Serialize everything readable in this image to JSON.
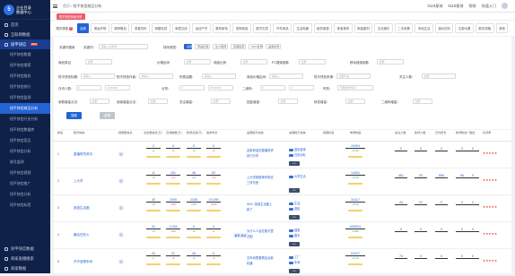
{
  "sidebar": {
    "logo_line1": "企业目录",
    "logo_line2": "数据中心",
    "home": "首页",
    "data_mgmt": "互联网数据",
    "group": "短平快信",
    "group_badge": "NEW",
    "items": [
      {
        "label": "短平快信数据"
      },
      {
        "label": "短平快信搜索"
      },
      {
        "label": "短平快信服务"
      },
      {
        "label": "短平快信排行"
      },
      {
        "label": "短平快信监测"
      },
      {
        "label": "短平快信商品分析",
        "active": true
      },
      {
        "label": "短平快信行业分析"
      },
      {
        "label": "短平快信数据库"
      },
      {
        "label": "短平快信竞品"
      },
      {
        "label": "短平快信分析"
      },
      {
        "label": "账号监测"
      },
      {
        "label": "短平快信视频"
      },
      {
        "label": "短平快信推广"
      },
      {
        "label": "短平快信分析"
      },
      {
        "label": "短平快信标签"
      }
    ],
    "bottom": [
      {
        "label": "短平快信数据"
      },
      {
        "label": "商家直播搜索"
      },
      {
        "label": "商家数据"
      }
    ]
  },
  "header": {
    "breadcrumb": [
      "首页",
      "短平快信商品分析"
    ],
    "right": [
      "5118星球",
      "5118星球",
      "帮助",
      "快速入门"
    ]
  },
  "tag": "短平快信商品分析",
  "menu": {
    "first": "短平快信",
    "first_badge": "2",
    "items": [
      "全部",
      "美妆护肤",
      "服饰鞋包",
      "零食饮料",
      "母婴玩具",
      "家居日用",
      "运动户外",
      "数码家电",
      "宠物用品",
      "图书文具",
      "汽车用品",
      "生活电器",
      "医药保健",
      "珠宝首饰",
      "家装建材",
      "文化娱乐",
      "二手闲置",
      "本地生活",
      "酒水饮料",
      "生鲜水果",
      "鲜花绿植",
      "其他"
    ]
  },
  "filters": {
    "row1_label": "关键词搜索",
    "row1_sub": "关键词：",
    "row1_ph": "请输入关键词",
    "row1_type": "排序类型：",
    "chips": [
      "全部",
      "商品标题",
      "达人昵称",
      "店铺名称",
      "SKU名称",
      "品牌名称"
    ],
    "row2": [
      {
        "label": "商品类目",
        "val": "全部",
        "label2": "品牌名称：",
        "val2": "全部"
      },
      {
        "label": "价格区间",
        "val": "全部"
      },
      {
        "label": "佣金比例",
        "val": "全部"
      },
      {
        "label": "PC搜索指数",
        "val": "全部"
      },
      {
        "label": "移动搜索指数",
        "val": "全部"
      }
    ],
    "row3": [
      {
        "label": "短平快信标题：",
        "ph": "请输入"
      },
      {
        "label": "短平快信作者：",
        "ph": "请输入"
      },
      {
        "label": "所属话题：",
        "ph": "请输入"
      },
      {
        "label": "商品价格区间：",
        "ph": "请输入"
      },
      {
        "label": "短平快信来源：",
        "ph": "全部平台"
      },
      {
        "label": "关注人数：",
        "ph": "全部"
      }
    ],
    "row4": [
      {
        "label": "日均人数：",
        "a": "0",
        "b": "1000000"
      },
      {
        "label": "点赞：",
        "a": "0",
        "b": "5000000"
      },
      {
        "label": "二维码：",
        "a": "0",
        "b": "4"
      },
      {
        "label": "时效：",
        "ph": "不限发布时间"
      }
    ],
    "row5": [
      {
        "label": "参数增量点击：",
        "val": "全部"
      },
      {
        "label": "阅读增量点击：",
        "val": "全部"
      },
      {
        "label": "关注增量：",
        "val": "全部"
      },
      {
        "label": "回复增量：",
        "val": "全部"
      },
      {
        "label": "转发增量：",
        "val": "全部"
      },
      {
        "label": "二维码增量：",
        "val": "全部"
      }
    ],
    "search_btn": "搜索",
    "reset_btn": "重置"
  },
  "table": {
    "headers": [
      "排名",
      "短平快信",
      "视频量信息",
      "点击量信息(万)",
      "互动数量(万)",
      "新增点赞(万)",
      "发布时长",
      "关联短平快信",
      "关联短平快信",
      "视频标签",
      "电商热度",
      "关注人数",
      "新增人数",
      "日均增长",
      "新增粉丝",
      "一致性",
      "好评率"
    ],
    "rows": [
      {
        "rank": "1",
        "name": "直播带货资讯",
        "v1": "2",
        "v1s": "+1",
        "v2": "0",
        "v2s": "+0",
        "v3": "0",
        "v3s": "+0",
        "v4": "0",
        "v4s": "+0",
        "topic": "这款商品的直播带货技巧分享",
        "kw": [
          "蓝色星球",
          "白色羽毛"
        ],
        "heat": "19394",
        "heat_s": "+5.6%",
        "h1": "0",
        "h2": "0",
        "h3": "0",
        "h4": "0",
        "h5": "0",
        "stars": "★★★★★"
      },
      {
        "rank": "2",
        "name": "上大学",
        "v1": "11",
        "v1s": "+3",
        "v2": "161",
        "v2s": "+41",
        "v3": "48",
        "v3s": "+12",
        "v4": "63",
        "v4s": "+15",
        "topic": "上大学我推荐你带这三样东西",
        "kw": [
          "大学生活"
        ],
        "heat": "14451",
        "heat_s": "+4.3%",
        "h1": "461",
        "h2": "93",
        "h3": "896",
        "h4": "96",
        "h5": "0",
        "stars": "★★★★★"
      },
      {
        "rank": "3",
        "name": "逛逛生活圈",
        "v1": "40",
        "v1s": "+8",
        "v2": "2490",
        "v2s": "+532",
        "v3": "2438",
        "v3s": "+470",
        "v4": "15,095",
        "v4s": "+3120",
        "topic": "WXC 逛逛生活圈上新了",
        "kw": [
          "生活",
          "逛街"
        ],
        "heat": "34117",
        "heat_s": "+6.1%",
        "h1": "43",
        "h2": "21",
        "h3": "0",
        "h4": "0",
        "h5": "0",
        "stars": "★★★★★"
      },
      {
        "rank": "4",
        "name": "最后还在火",
        "v1": "41",
        "v1s": "+9",
        "v2": "1,016",
        "v2s": "+210",
        "v3": "0",
        "v3s": "+0",
        "v4": "3",
        "v4s": "+1",
        "topic": "为什么人会在春天里犯困",
        "kw": [
          "健康",
          "春天"
        ],
        "heat": "699024",
        "heat_s": "+9.8%",
        "h1": "0",
        "h2": "0",
        "h3": "0",
        "h4": "0",
        "h5": "0",
        "stars": "★★★★★",
        "extra": "推荐 热榜"
      },
      {
        "rank": "5",
        "name": "开不遗是车间",
        "v1": "43",
        "v1s": "+7",
        "v2": "22",
        "v2s": "+5",
        "v3": "46",
        "v3s": "+9",
        "v4": "0",
        "v4s": "+0",
        "topic": "去车间里看看这台新机器",
        "kw": [
          "工厂",
          "车间"
        ],
        "heat": "51027",
        "heat_s": "+2.7%",
        "h1": "73",
        "h2": "0",
        "h3": "0",
        "h4": "0",
        "h5": "0",
        "stars": "★★★★★"
      }
    ]
  }
}
